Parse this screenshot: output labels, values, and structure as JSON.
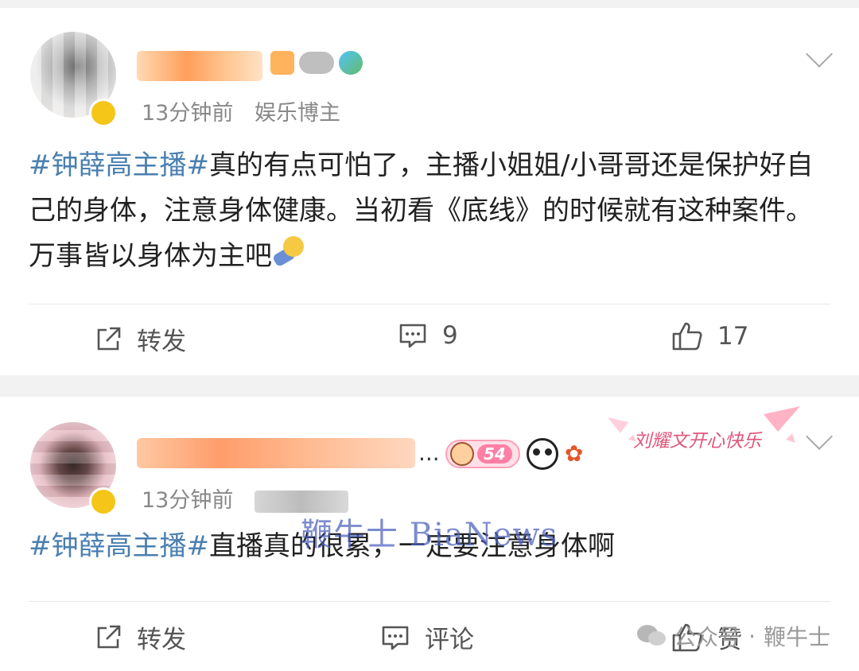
{
  "posts": [
    {
      "time": "13分钟前",
      "role": "娱乐博主",
      "hashtag": "#钟薛高主播#",
      "text": "真的有点可怕了，主播小姐姐/小哥哥还是保护好自己的身体，注意身体健康。当初看《底线》的时候就有这种案件。万事皆以身体为主吧",
      "emoji": "sleep-emoji",
      "actions": {
        "repost": "转发",
        "comment": "9",
        "like": "17"
      }
    },
    {
      "time": "13分钟前",
      "username_suffix": "...",
      "badge_number": "54",
      "sticker_text": "刘耀文开心快乐",
      "hashtag": "#钟薛高主播#",
      "text": "直播真的很累，一定要注意身体啊",
      "actions": {
        "repost": "转发",
        "comment": "评论",
        "like": "赞"
      }
    }
  ],
  "watermark": "鞭牛士 BiaNews",
  "footer_watermark": {
    "source": "公众号",
    "separator": "·",
    "name": "鞭牛士"
  },
  "colors": {
    "hashtag": "#4a7fb0",
    "background": "#f2f2f2",
    "watermark": "#4b5fbf"
  }
}
